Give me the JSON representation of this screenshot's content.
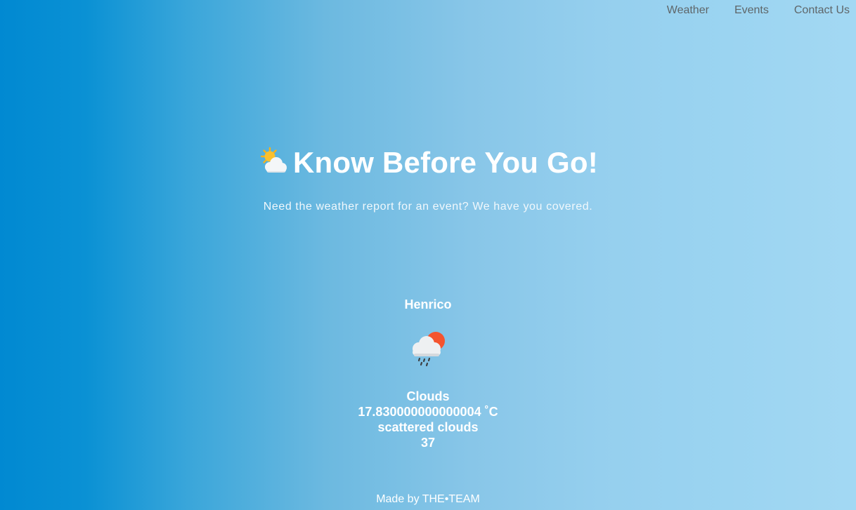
{
  "nav": {
    "items": [
      {
        "label": "Weather"
      },
      {
        "label": "Events"
      },
      {
        "label": "Contact Us"
      }
    ]
  },
  "hero": {
    "icon": "sun-behind-cloud-icon",
    "title": "Know Before You Go!",
    "subtitle": "Need the weather report for an event? We have you covered."
  },
  "weather": {
    "city": "Henrico",
    "icon": "cloud-sun-rain-icon",
    "main": "Clouds",
    "temperature": "17.830000000000004 ˚C",
    "description": "scattered clouds",
    "humidity": "37"
  },
  "footer": {
    "text": "Made by THE•TEAM"
  },
  "colors": {
    "gradient_left": "#0189d2",
    "gradient_right": "#a3d8f3",
    "nav_text": "#5f6669",
    "text": "#ffffff"
  }
}
